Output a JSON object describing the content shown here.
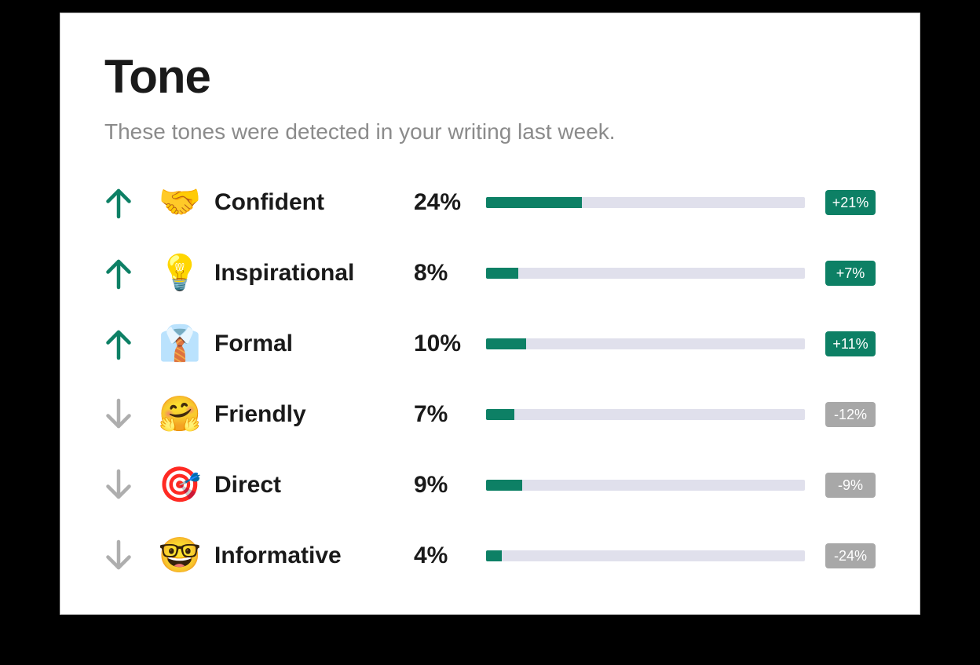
{
  "title": "Tone",
  "subtitle": "These tones were detected in your writing last week.",
  "colors": {
    "accent": "#0d8065",
    "muted": "#a8a8a8",
    "track": "#e0e0ec"
  },
  "bar_scale_max": 80,
  "tones": [
    {
      "label": "Confident",
      "emoji": "🤝",
      "percent": 24,
      "delta": 21,
      "trend": "up"
    },
    {
      "label": "Inspirational",
      "emoji": "💡",
      "percent": 8,
      "delta": 7,
      "trend": "up"
    },
    {
      "label": "Formal",
      "emoji": "👔",
      "percent": 10,
      "delta": 11,
      "trend": "up"
    },
    {
      "label": "Friendly",
      "emoji": "🤗",
      "percent": 7,
      "delta": -12,
      "trend": "down"
    },
    {
      "label": "Direct",
      "emoji": "🎯",
      "percent": 9,
      "delta": -9,
      "trend": "down"
    },
    {
      "label": "Informative",
      "emoji": "🤓",
      "percent": 4,
      "delta": -24,
      "trend": "down"
    }
  ],
  "chart_data": {
    "type": "bar",
    "title": "Tone",
    "subtitle": "These tones were detected in your writing last week.",
    "xlabel": "",
    "ylabel": "",
    "ylim": [
      0,
      80
    ],
    "categories": [
      "Confident",
      "Inspirational",
      "Formal",
      "Friendly",
      "Direct",
      "Informative"
    ],
    "series": [
      {
        "name": "percent",
        "values": [
          24,
          8,
          10,
          7,
          9,
          4
        ]
      },
      {
        "name": "delta",
        "values": [
          21,
          7,
          11,
          -12,
          -9,
          -24
        ]
      }
    ]
  }
}
